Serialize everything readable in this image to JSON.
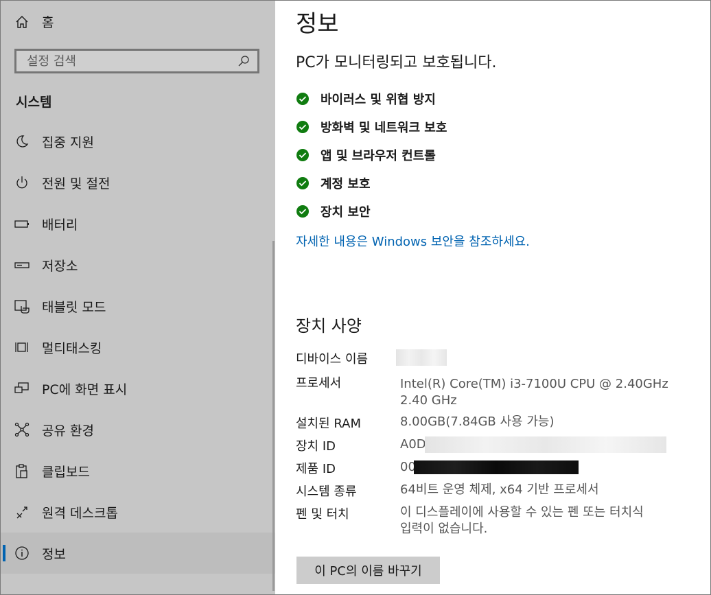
{
  "sidebar": {
    "home_label": "홈",
    "search_placeholder": "설정 검색",
    "section_title": "시스템",
    "items": [
      {
        "label": "집중 지원",
        "icon": "moon-icon"
      },
      {
        "label": "전원 및 절전",
        "icon": "power-icon"
      },
      {
        "label": "배터리",
        "icon": "battery-icon"
      },
      {
        "label": "저장소",
        "icon": "storage-icon"
      },
      {
        "label": "태블릿 모드",
        "icon": "tablet-mode-icon"
      },
      {
        "label": "멀티태스킹",
        "icon": "multitasking-icon"
      },
      {
        "label": "PC에 화면 표시",
        "icon": "project-icon"
      },
      {
        "label": "공유 환경",
        "icon": "share-icon"
      },
      {
        "label": "클립보드",
        "icon": "clipboard-icon"
      },
      {
        "label": "원격 데스크톱",
        "icon": "remote-desktop-icon"
      },
      {
        "label": "정보",
        "icon": "info-icon",
        "active": true
      }
    ]
  },
  "main": {
    "title": "정보",
    "monitor_heading": "PC가 모니터링되고 보호됩니다.",
    "protections": [
      "바이러스 및 위협 방지",
      "방화벽 및 네트워크 보호",
      "앱 및 브라우저 컨트롤",
      "계정 보호",
      "장치 보안"
    ],
    "more_link": "자세한 내용은 Windows 보안을 참조하세요.",
    "spec_heading": "장치 사양",
    "specs": {
      "device_name_label": "디바이스 이름",
      "processor_label": "프로세서",
      "processor_value_line1": "Intel(R) Core(TM) i3-7100U CPU @ 2.40GHz",
      "processor_value_line2": "2.40 GHz",
      "ram_label": "설치된 RAM",
      "ram_value": "8.00GB(7.84GB 사용 가능)",
      "device_id_label": "장치 ID",
      "device_id_value": "A0D",
      "product_id_label": "제품 ID",
      "product_id_value": "00",
      "system_type_label": "시스템 종류",
      "system_type_value": "64비트 운영 체제, x64 기반 프로세서",
      "pen_label": "펜 및 터치",
      "pen_value_line1": "이 디스플레이에 사용할 수 있는 펜 또는 터치식",
      "pen_value_line2": "입력이 없습니다."
    },
    "rename_button": "이 PC의 이름 바꾸기"
  },
  "colors": {
    "sidebar_bg": "#c6c6c6",
    "accent": "#0063b1",
    "check_green": "#107c10"
  }
}
